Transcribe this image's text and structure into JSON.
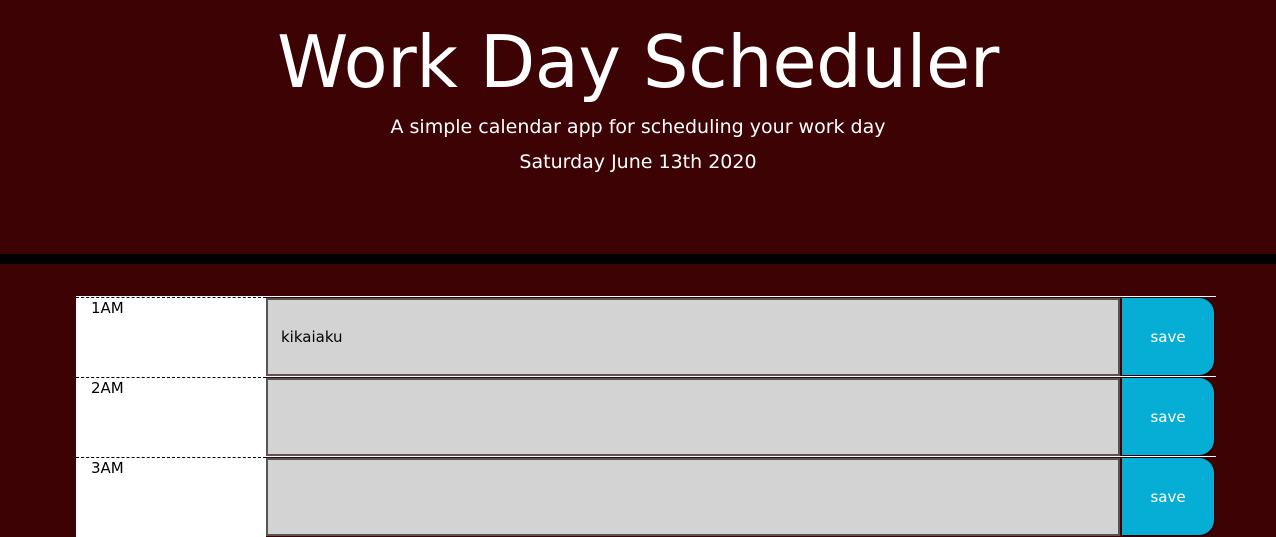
{
  "header": {
    "title": "Work Day Scheduler",
    "subtitle": "A simple calendar app for scheduling your work day",
    "current_day": "Saturday June 13th 2020"
  },
  "time_blocks": [
    {
      "hour": "1AM",
      "description": "kikaiaku",
      "save_label": "save"
    },
    {
      "hour": "2AM",
      "description": "",
      "save_label": "save"
    },
    {
      "hour": "3AM",
      "description": "",
      "save_label": "save"
    }
  ],
  "colors": {
    "background": "#3d0204",
    "divider": "#000000",
    "textarea": "#d3d3d3",
    "save_button": "#06aed5",
    "hour_block": "#ffffff"
  }
}
